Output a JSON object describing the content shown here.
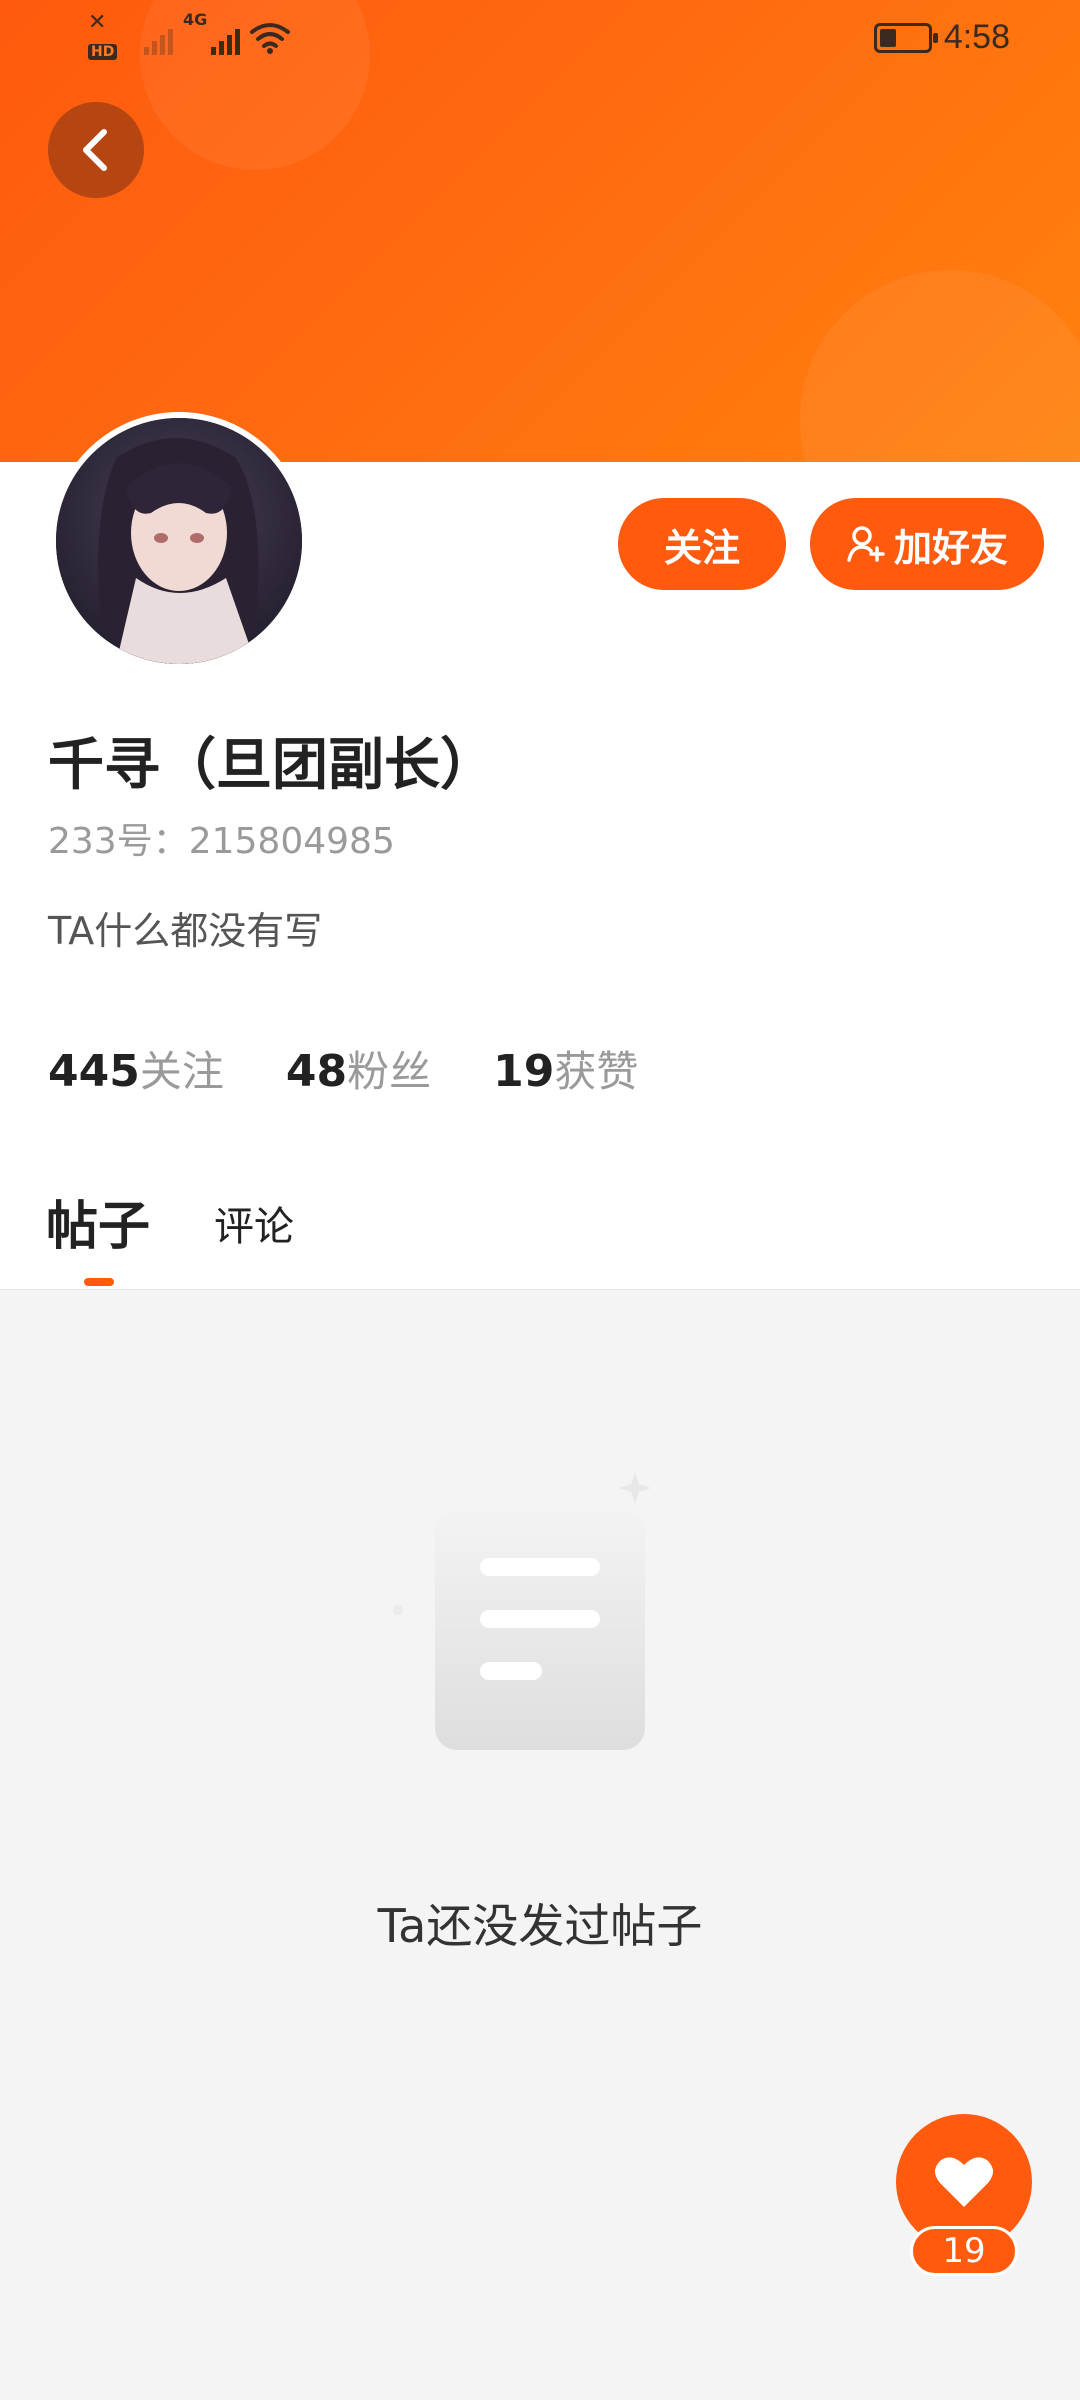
{
  "status_bar": {
    "time": "4:58",
    "signal_label": "4G",
    "hd_label": "HD",
    "battery_level": 0.35,
    "icons": [
      "sim-off-icon",
      "signal-icon",
      "wifi-icon",
      "battery-icon"
    ]
  },
  "header": {
    "back_icon": "chevron-left-icon",
    "colors": {
      "accent": "#ff5a0e",
      "gradient_end": "#ff820e"
    }
  },
  "profile": {
    "name": "千寻（旦团副长）",
    "uid": "233号：215804985",
    "bio": "TA什么都没有写",
    "follow_label": "关注",
    "add_friend_label": "加好友",
    "add_friend_icon": "add-user-icon"
  },
  "stats": [
    {
      "value": "445",
      "label": "关注"
    },
    {
      "value": "48",
      "label": "粉丝"
    },
    {
      "value": "19",
      "label": "获赞"
    }
  ],
  "tabs": {
    "posts": "帖子",
    "comments": "评论",
    "active": "posts"
  },
  "empty_state": {
    "icon": "document-icon",
    "text": "Ta还没发过帖子"
  },
  "fab": {
    "icon": "heart-icon",
    "count": "19"
  }
}
